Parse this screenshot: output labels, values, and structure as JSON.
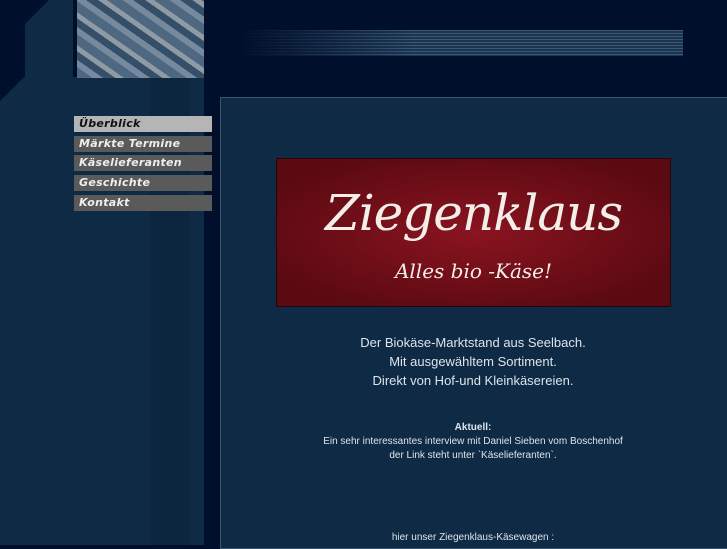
{
  "nav": [
    {
      "label": "Überblick",
      "active": true
    },
    {
      "label": "Märkte Termine"
    },
    {
      "label": "Käselieferanten"
    },
    {
      "label": "Geschichte"
    },
    {
      "label": "Kontakt"
    }
  ],
  "banner": {
    "title": "Ziegenklaus",
    "subtitle": "Alles bio -Käse!"
  },
  "intro": [
    "Der Biokäse-Marktstand aus Seelbach.",
    "Mit ausgewähltem Sortiment.",
    "Direkt von Hof-und Kleinkäsereien."
  ],
  "news": {
    "heading": "Aktuell:",
    "lines": [
      "Ein sehr interessantes interview mit Daniel Sieben vom Boschenhof",
      "der Link steht unter `Käselieferanten`."
    ]
  },
  "wagon_caption": "hier unser Ziegenklaus-Käsewagen :"
}
